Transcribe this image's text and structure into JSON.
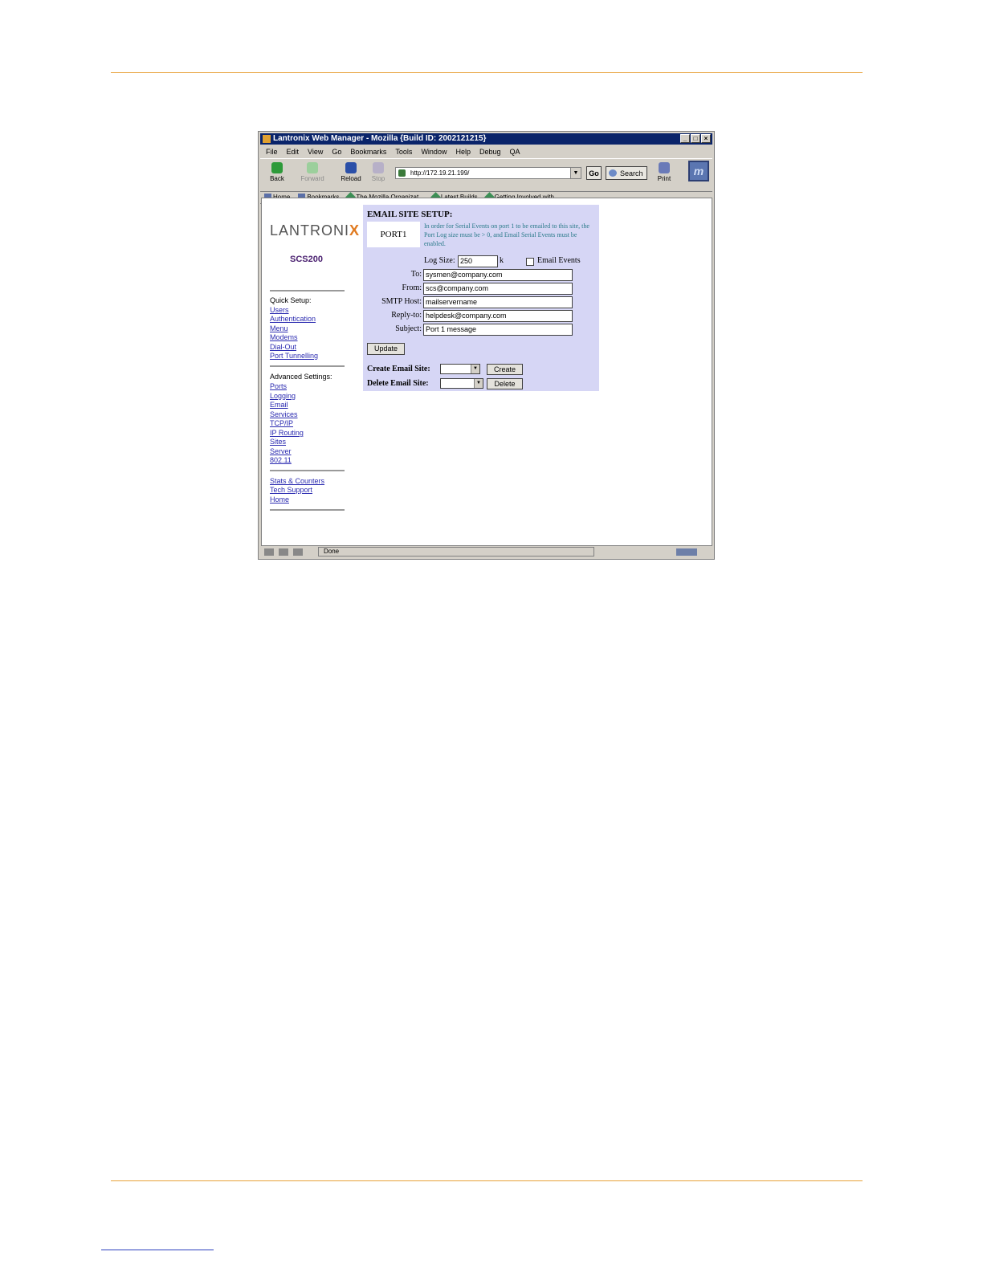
{
  "window": {
    "title": "Lantronix Web Manager - Mozilla {Build ID: 2002121215}",
    "controls": [
      "_",
      "□",
      "×"
    ]
  },
  "menu": [
    "File",
    "Edit",
    "View",
    "Go",
    "Bookmarks",
    "Tools",
    "Window",
    "Help",
    "Debug",
    "QA"
  ],
  "toolbar": {
    "back": "Back",
    "forward": "Forward",
    "reload": "Reload",
    "stop": "Stop",
    "url": "http://172.19.21.199/",
    "go": "Go",
    "search": "Search",
    "print": "Print"
  },
  "personal_toolbar": [
    "Home",
    "Bookmarks",
    "The Mozilla Organizat...",
    "Latest Builds",
    "Getting Involved with..."
  ],
  "status": {
    "text": "Done"
  },
  "sidebar": {
    "logo_text": "LANTRONI",
    "logo_x": "X",
    "model": "SCS200",
    "quick_heading": "Quick Setup:",
    "quick_links": [
      "Users",
      "Authentication",
      "Menu",
      "Modems",
      "Dial-Out",
      "Port Tunnelling"
    ],
    "advanced_heading": "Advanced Settings:",
    "advanced_links": [
      "Ports",
      "Logging",
      "Email",
      "Services",
      "TCP/IP",
      "IP Routing",
      "Sites",
      "Server",
      "802.11"
    ],
    "other_links": [
      "Stats & Counters",
      "Tech Support",
      "Home"
    ]
  },
  "panel": {
    "title": "EMAIL SITE SETUP:",
    "port": "PORT1",
    "info": "In order for Serial Events on port 1 to be emailed to this site, the Port Log size must be > 0, and Email Serial Events must be enabled.",
    "log_size_label": "Log Size:",
    "log_size_value": "250",
    "log_size_unit": "k",
    "email_events_label": "Email Events",
    "email_events_checked": false,
    "to_label": "To:",
    "to_value": "sysmen@company.com",
    "from_label": "From:",
    "from_value": "scs@company.com",
    "smtp_label": "SMTP Host:",
    "smtp_value": "mailservername",
    "reply_label": "Reply-to:",
    "reply_value": "helpdesk@company.com",
    "subject_label": "Subject:",
    "subject_value": "Port 1 message",
    "update_button": "Update",
    "create_label": "Create Email Site:",
    "create_button": "Create",
    "delete_label": "Delete Email Site:",
    "delete_button": "Delete"
  }
}
